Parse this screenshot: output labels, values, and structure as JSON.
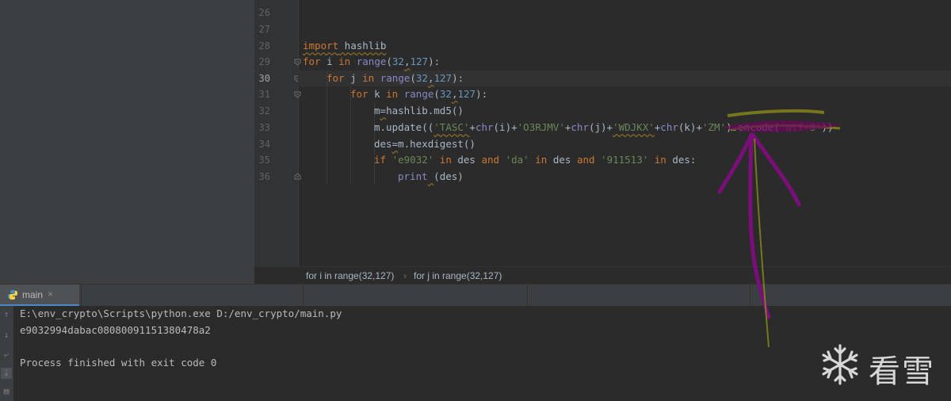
{
  "editor": {
    "line_numbers": [
      "26",
      "27",
      "28",
      "29",
      "30",
      "31",
      "32",
      "33",
      "34",
      "35",
      "36"
    ],
    "current_line": "30",
    "code": {
      "l28": {
        "kw": "import",
        "mod": " hashlib"
      },
      "l29": {
        "kw1": "for",
        "v": " i ",
        "kw2": "in",
        "fn": " range",
        "p1": "(",
        "n1": "32",
        "c": ",",
        "n2": "127",
        "p2": "):"
      },
      "l30": {
        "kw1": "for",
        "v": " j ",
        "kw2": "in",
        "fn": " range",
        "p1": "(",
        "n1": "32",
        "c": ",",
        "n2": "127",
        "p2": "):"
      },
      "l31": {
        "kw1": "for",
        "v": " k ",
        "kw2": "in",
        "fn": " range",
        "p1": "(",
        "n1": "32",
        "c": ",",
        "n2": "127",
        "p2": "):"
      },
      "l32": {
        "a": "m",
        "b": "=",
        "c": "hashlib.md5()"
      },
      "l33": {
        "a": "m.update((",
        "s1": "'TASC'",
        "b": "+",
        "chr1": "chr",
        "c": "(i)+",
        "s2": "'O3RJMV'",
        "d": "+",
        "chr2": "chr",
        "e": "(j)+",
        "s3": "'WDJKX'",
        "f": "+",
        "chr3": "chr",
        "g": "(k)+",
        "s4": "'ZM'",
        "h": ").encode(",
        "s5": "'utf-8'",
        "i": "))"
      },
      "l34": {
        "a": "des",
        "b": "=",
        "c": "m.hexdigest()"
      },
      "l35": {
        "kw1": "if",
        "s1": " 'e9032'",
        "kw2": " in",
        "v1": " des ",
        "kw3": "and",
        "s2": " 'da'",
        "kw4": " in",
        "v2": " des ",
        "kw5": "and",
        "s3": " '911513'",
        "kw6": " in",
        "v3": " des:"
      },
      "l36": {
        "fn": "print",
        "a": " ",
        "b": "(des)"
      }
    }
  },
  "breadcrumbs": [
    "for i in range(32,127)",
    "for j in range(32,127)"
  ],
  "run_panel": {
    "tab_label": "main",
    "close_glyph": "×",
    "console": [
      "E:\\env_crypto\\Scripts\\python.exe D:/env_crypto/main.py",
      "e9032994dabac08080091151380478a2",
      "",
      "Process finished with exit code 0"
    ]
  },
  "watermark": {
    "text": "看雪"
  },
  "colors": {
    "keyword": "#cc7832",
    "string": "#6a8759",
    "number": "#6897bb",
    "builtin": "#8888c6",
    "text": "#a9b7c6",
    "annotation_purple": "#7a0f7a",
    "annotation_olive": "#8a8a1a"
  }
}
